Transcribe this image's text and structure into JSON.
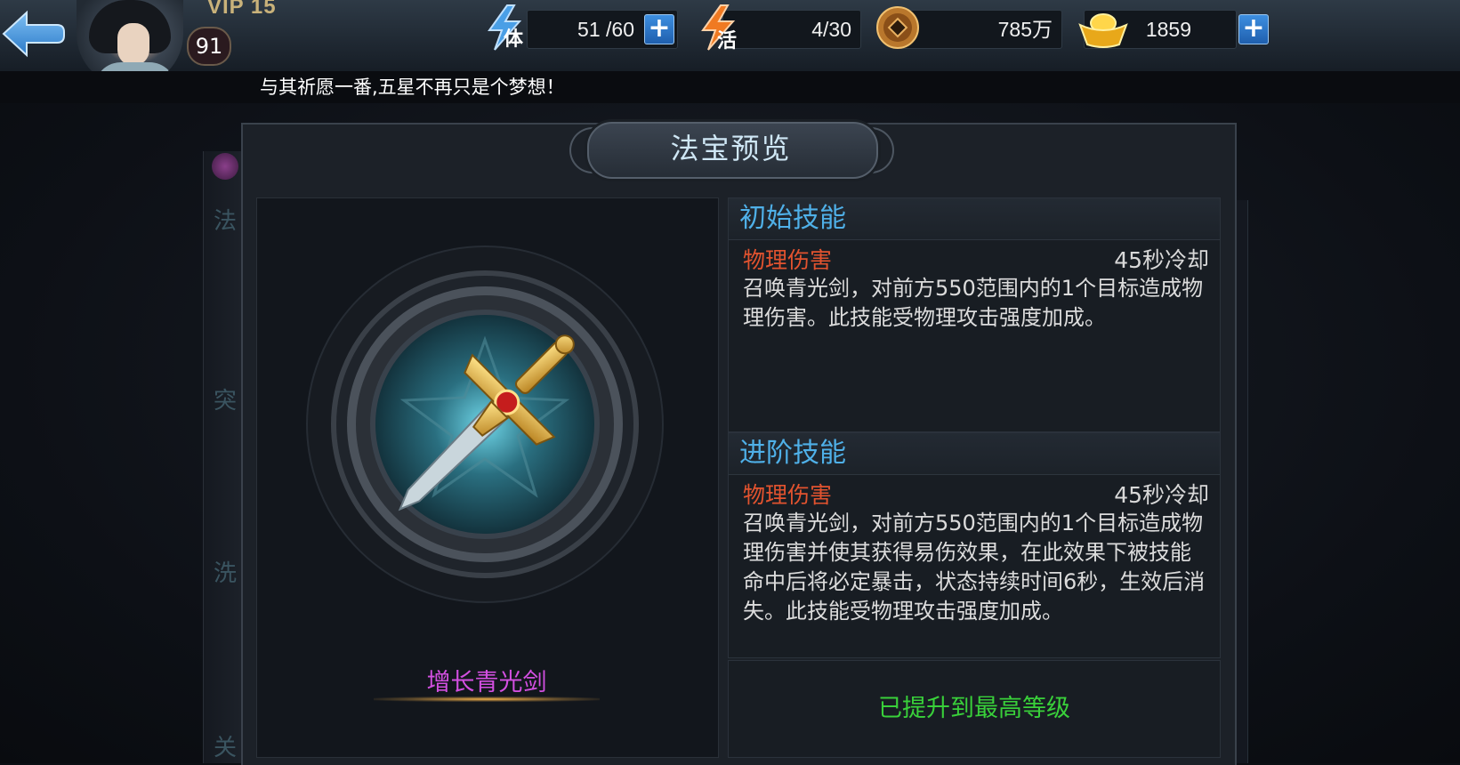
{
  "topbar": {
    "vip_label": "VIP 15",
    "player_level": "91",
    "stamina": {
      "icon_char": "体",
      "value": "51 /60"
    },
    "activity": {
      "icon_char": "活",
      "value": "4/30"
    },
    "copper": {
      "value": "785万"
    },
    "gold": {
      "value": "1859"
    },
    "plus_symbol": "+"
  },
  "marquee": {
    "text": "与其祈愿一番,五星不再只是个梦想！"
  },
  "background": {
    "left_chars": [
      "法",
      "突",
      "洗",
      "关"
    ]
  },
  "dialog": {
    "title": "法宝预览",
    "item_name": "增长青光剑",
    "initial_skill": {
      "header": "初始技能",
      "type": "物理伤害",
      "cooldown": "45秒冷却",
      "description": "召唤青光剑，对前方550范围内的1个目标造成物理伤害。此技能受物理攻击强度加成。"
    },
    "advanced_skill": {
      "header": "进阶技能",
      "type": "物理伤害",
      "cooldown": "45秒冷却",
      "description": "召唤青光剑，对前方550范围内的1个目标造成物理伤害并使其获得易伤效果，在此效果下被技能命中后将必定暴击，状态持续时间6秒，生效后消失。此技能受物理攻击强度加成。"
    },
    "max_level_text": "已提升到最高等级"
  },
  "colors": {
    "section_title": "#4fb0e8",
    "skill_type": "#e2532f",
    "item_name": "#d24fe0",
    "max_level": "#39d03a"
  }
}
